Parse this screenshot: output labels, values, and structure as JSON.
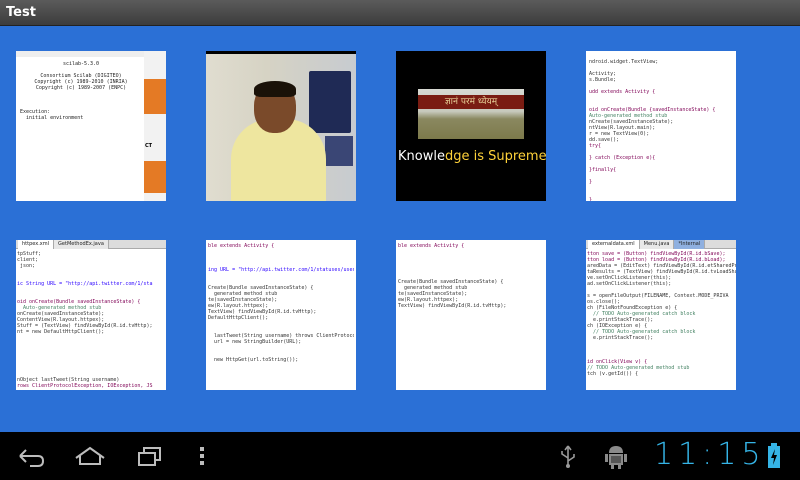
{
  "app": {
    "title": "Test"
  },
  "thumbnails": [
    {
      "kind": "scilab-console",
      "lines": [
        "scilab-5.3.0",
        "",
        "Consortium Scilab (DIGITEO)",
        "Copyright (c) 1989-2010 (INRIA)",
        "Copyright (c) 1989-2007 (ENPC)",
        "",
        "",
        "",
        "Execution:",
        "  initial environment"
      ],
      "side_text": "CT"
    },
    {
      "kind": "video-lecture"
    },
    {
      "kind": "title-card",
      "banner": "ज्ञानं परमं ध्येयम्",
      "caption_part1": "Knowle",
      "caption_part2": "dge is Supreme"
    },
    {
      "kind": "code",
      "lines": [
        "ndroid.widget.TextView;",
        "",
        "Activity;",
        "s.Bundle;",
        "",
        "udd extends Activity {",
        "",
        "",
        "oid onCreate(Bundle {savedInstanceState) {",
        "Auto-generated method stub",
        "nCreate(savedInstanceState);",
        "ntView(R.layout.main);",
        "r = new TextView(0);",
        "dd.save();",
        "try{",
        "",
        "} catch (Exception e){",
        "",
        "}finally{",
        "",
        "}",
        "",
        "",
        "}"
      ]
    },
    {
      "kind": "code",
      "tabs": [
        "httpex.xml",
        "GetMethodEx.java"
      ],
      "lines": [
        "tpStuff;",
        "client;",
        " json;",
        "",
        "",
        "ic String URL = \"http://api.twitter.com/1/sta",
        "",
        "",
        "oid onCreate(Bundle savedInstanceState) {",
        "  Auto-generated method stub",
        "onCreate(savedInstanceState);",
        "ContentView(R.layout.httpex);",
        "Stuff = (TextView) findViewById(R.id.tvHttp);",
        "nt = new DefaultHttpClient();",
        "",
        "",
        "",
        "",
        "",
        "",
        "",
        "nObject lastTweet(String username)",
        "rows ClientProtocolException, IOException, JS"
      ]
    },
    {
      "kind": "code",
      "lines": [
        "ble extends Activity {",
        "",
        "",
        "",
        "ing URL = \"http://api.twitter.com/1/statuses/user_timeline.j",
        "",
        "",
        "Create(Bundle savedInstanceState) {",
        "  generated method stub",
        "te(savedInstanceState);",
        "ew(R.layout.httpex);",
        "TextView) findViewById(R.id.tvHttp);",
        "DefaultHttpClient();",
        "",
        "",
        "  lastTweet(String username) throws ClientProtocolException,",
        "  url = new StringBuilder(URL);",
        "",
        "",
        "  new HttpGet(url.toString());"
      ]
    },
    {
      "kind": "code",
      "lines": [
        "ble extends Activity {",
        "",
        "",
        "",
        "",
        "",
        "Create(Bundle savedInstanceState) {",
        "  generated method stub",
        "te(savedInstanceState);",
        "ew(R.layout.httpex);",
        "TextView) findViewById(R.id.tvHttp);"
      ]
    },
    {
      "kind": "code",
      "tabs": [
        "externaldata.xml",
        "Menu.java",
        "*Internal"
      ],
      "lines": [
        "tton save = (Button) findViewById(R.id.bSave);",
        "tton load = (Button) findViewById(R.id.bLoad);",
        "aredData = (EditText) findViewById(R.id.etSharedPre",
        "taResults = (TextView) findViewById(R.id.tvLoadShare",
        "ve.setOnClickListener(this);",
        "ad.setOnClickListener(this);",
        "",
        "s = openFileOutput(FILENAME, Context.MODE_PRIVA",
        "os.close();",
        "ch (FileNotFoundException e) {",
        "  // TODO Auto-generated catch block",
        "  e.printStackTrace();",
        "ch (IOException e) {",
        "  // TODO Auto-generated catch block",
        "  e.printStackTrace();",
        "",
        "",
        "",
        "id onClick(View v) {",
        "// TODO Auto-generated method stub",
        "tch (v.getId()) {"
      ]
    }
  ],
  "navbar": {
    "back_icon": "back-icon",
    "home_icon": "home-icon",
    "recents_icon": "recent-apps-icon",
    "menu_icon": "overflow-menu-icon"
  },
  "status": {
    "time": "11:15",
    "usb_icon": "usb-icon",
    "debug_icon": "android-debug-icon",
    "battery_icon": "battery-charging-icon",
    "accent": "#35b4e6"
  }
}
